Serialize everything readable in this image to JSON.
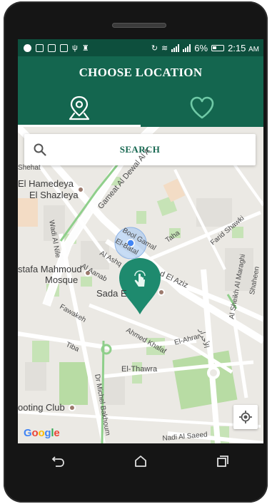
{
  "status_bar": {
    "battery_percent": "6%",
    "time": "2:15",
    "ampm": "AM"
  },
  "toolbar": {
    "title": "CHOOSE LOCATION"
  },
  "tabs": [
    {
      "icon": "map-pin-icon",
      "selected": true
    },
    {
      "icon": "heart-icon",
      "selected": false
    }
  ],
  "search": {
    "label": "SEARCH"
  },
  "map": {
    "labels": {
      "el_hamedeya_1": "El Hamedeya",
      "el_hamedeya_2": "El Shazleya",
      "gameat_al_dewal": "Gameat Al Dewal Al A",
      "wadi_al_nile": "Wadi Al Nile",
      "mostafa_1": "stafa Mahmoud",
      "mostafa_2": "Mosque",
      "sada": "Sada E",
      "al_aanab": "Al Aanab",
      "al_ashqar": "Al Ashq",
      "bool_gamal": "Bool Gamal",
      "el_batal": "El-Batal",
      "taha": "Taha",
      "farid_shawki": "Farid Shawki",
      "el_aziz": "d El Aziz",
      "fawakeh": "Fawakeh",
      "ahmed_khalaf": "Ahmed Khalaf",
      "el_ahrar": "El-Ahrar",
      "arabic": "الأحرار",
      "tiba": "Tiba",
      "el_thawra": "El-Thawra",
      "michel_bakhoum": "Dr Michel Bakhoum",
      "shooting_club": "ooting Club",
      "nadi_al_saeed": "Nadi Al Saeed",
      "sheikh_maraghi": "Al Sheikh Al Maraghi",
      "shaheen": "Shaheen",
      "shehat": "Shehat"
    },
    "google_logo": "Google"
  },
  "colors": {
    "primary": "#14664f",
    "primary_dark": "#0d4f3d",
    "marker": "#1e8a6e",
    "accent_heart": "#6fc9a6"
  }
}
